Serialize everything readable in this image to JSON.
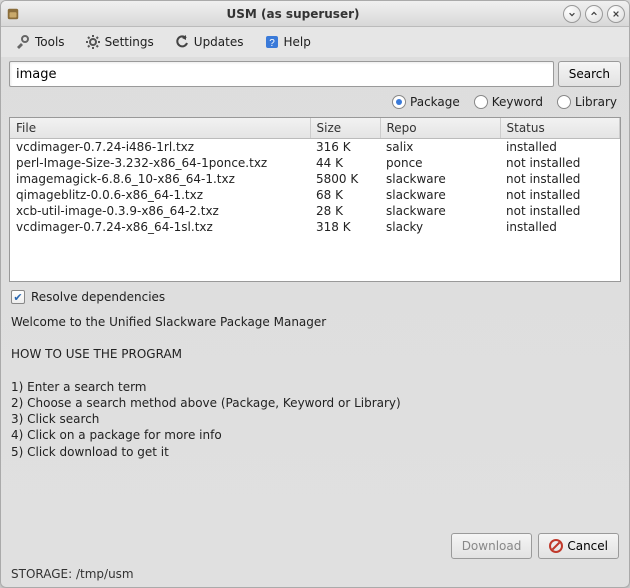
{
  "window": {
    "title": "USM (as superuser)"
  },
  "menu": {
    "tools": "Tools",
    "settings": "Settings",
    "updates": "Updates",
    "help": "Help"
  },
  "search": {
    "value": "image",
    "button": "Search"
  },
  "radios": {
    "package": "Package",
    "keyword": "Keyword",
    "library": "Library",
    "selected": "package"
  },
  "table": {
    "headers": {
      "file": "File",
      "size": "Size",
      "repo": "Repo",
      "status": "Status"
    },
    "rows": [
      {
        "file": "vcdimager-0.7.24-i486-1rl.txz",
        "size": "316 K",
        "repo": "salix",
        "status": "installed"
      },
      {
        "file": "perl-Image-Size-3.232-x86_64-1ponce.txz",
        "size": "44 K",
        "repo": "ponce",
        "status": "not installed"
      },
      {
        "file": "imagemagick-6.8.6_10-x86_64-1.txz",
        "size": "5800 K",
        "repo": "slackware",
        "status": "not installed"
      },
      {
        "file": "qimageblitz-0.0.6-x86_64-1.txz",
        "size": "68 K",
        "repo": "slackware",
        "status": "not installed"
      },
      {
        "file": "xcb-util-image-0.3.9-x86_64-2.txz",
        "size": "28 K",
        "repo": "slackware",
        "status": "not installed"
      },
      {
        "file": "vcdimager-0.7.24-x86_64-1sl.txz",
        "size": "318 K",
        "repo": "slacky",
        "status": "installed"
      }
    ]
  },
  "resolve_deps": {
    "label": "Resolve dependencies",
    "checked": true
  },
  "info_text": "Welcome to the Unified Slackware Package Manager\n\nHOW TO USE THE PROGRAM\n\n1) Enter a search term\n2) Choose a search method above (Package, Keyword or Library)\n3) Click search\n4) Click on a package for more info\n5) Click download to get it",
  "buttons": {
    "download": "Download",
    "cancel": "Cancel"
  },
  "status_bar": "STORAGE: /tmp/usm"
}
